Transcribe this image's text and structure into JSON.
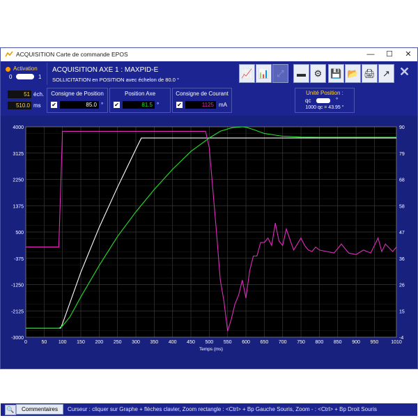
{
  "window": {
    "title": "ACQUISITION Carte de commande EPOS"
  },
  "window_controls": {
    "minimize": "—",
    "maximize": "☐",
    "close": "✕"
  },
  "activation": {
    "label": "Activation",
    "off": "0",
    "on": "1",
    "state": "on"
  },
  "header": {
    "title": "ACQUISITION AXE 1 : MAXPID-E",
    "subtitle": "SOLLICITATION en POSITION avec échelon de 80.0 °"
  },
  "toolbar": {
    "icons": [
      "chart-edit-icon",
      "chart-color-icon",
      "chart-disabled-icon",
      "battery-icon",
      "gears-icon",
      "save-icon",
      "open-folder-icon",
      "print-icon",
      "export-icon",
      "close-icon"
    ],
    "close_label": "✕"
  },
  "acquisition": {
    "samples_value": "51",
    "samples_unit": "éch.",
    "period_value": "510.0",
    "period_unit": "ms"
  },
  "consigne_position": {
    "label": "Consigne de Position",
    "checked": true,
    "value": "85.0",
    "unit": "°",
    "color": "#ffffff"
  },
  "position_axe": {
    "label": "Position Axe",
    "checked": true,
    "value": "81.5",
    "unit": "°",
    "color": "#25e02b"
  },
  "consigne_courant": {
    "label": "Consigne de Courant",
    "checked": true,
    "value": "1125",
    "unit": "mA",
    "color": "#e02cbf"
  },
  "unite_position": {
    "title": "Unité Position :",
    "left": "qc",
    "right": "°",
    "conversion": "1000 qc = 43.95 °"
  },
  "chart_data": {
    "type": "line",
    "xlabel": "Temps (ms)",
    "xlim": [
      0,
      1010
    ],
    "x_ticks": [
      0,
      50,
      100,
      150,
      200,
      250,
      300,
      350,
      400,
      450,
      500,
      550,
      600,
      650,
      700,
      750,
      800,
      850,
      900,
      950,
      1010
    ],
    "y_left_lim": [
      -3000,
      4000
    ],
    "y_left_ticks": [
      4000,
      3125,
      2250,
      1375,
      500,
      -375,
      -1250,
      -2125,
      -3000
    ],
    "y_right_lim": [
      -4,
      90
    ],
    "y_right_ticks": [
      90,
      79,
      68,
      58,
      47,
      36,
      26,
      15,
      -4
    ],
    "grid": true,
    "series": [
      {
        "name": "Consigne de Position",
        "color": "#ffffff",
        "axis": "right",
        "x": [
          0,
          95,
          100,
          150,
          200,
          250,
          300,
          315,
          400,
          500,
          600,
          700,
          800,
          900,
          1010
        ],
        "y": [
          0,
          0,
          2,
          25,
          45,
          63,
          80,
          85,
          85,
          85,
          85,
          85,
          85,
          85,
          85
        ]
      },
      {
        "name": "Position Axe",
        "color": "#25e02b",
        "axis": "right",
        "x": [
          0,
          90,
          100,
          120,
          150,
          200,
          250,
          300,
          350,
          400,
          450,
          500,
          530,
          560,
          590,
          600,
          620,
          650,
          700,
          750,
          800,
          900,
          1010
        ],
        "y": [
          0,
          0,
          1,
          5,
          14,
          28,
          41,
          52,
          62,
          71,
          79,
          85,
          88,
          89.5,
          90,
          89.8,
          88.8,
          87,
          85.8,
          85.4,
          85.3,
          85.3,
          85.3
        ],
        "display_scale": "left"
      },
      {
        "name": "Consigne de Courant",
        "color": "#e02cbf",
        "axis": "left",
        "x": [
          0,
          90,
          100,
          300,
          490,
          500,
          520,
          530,
          540,
          550,
          560,
          570,
          580,
          590,
          600,
          610,
          620,
          630,
          640,
          650,
          660,
          670,
          680,
          690,
          700,
          710,
          720,
          730,
          740,
          750,
          760,
          770,
          780,
          790,
          800,
          820,
          840,
          860,
          880,
          900,
          920,
          940,
          960,
          970,
          980,
          1000,
          1010
        ],
        "y": [
          0,
          0,
          3850,
          3850,
          3850,
          3300,
          450,
          -1100,
          -1800,
          -2800,
          -2400,
          -1900,
          -1600,
          -1100,
          -1700,
          -800,
          -300,
          -300,
          150,
          150,
          300,
          50,
          800,
          200,
          50,
          600,
          250,
          -100,
          100,
          300,
          50,
          -100,
          -150,
          0,
          -100,
          -150,
          -200,
          100,
          -200,
          -250,
          -100,
          -200,
          300,
          -150,
          100,
          -150,
          0
        ]
      }
    ]
  },
  "status_bar": {
    "comments_label": "Commentaires",
    "hint": "Curseur : cliquer sur Graphe + flèches clavier, Zoom rectangle : <Ctrl> + Bp Gauche Souris, Zoom - : <Ctrl> + Bp Droit Souris"
  }
}
